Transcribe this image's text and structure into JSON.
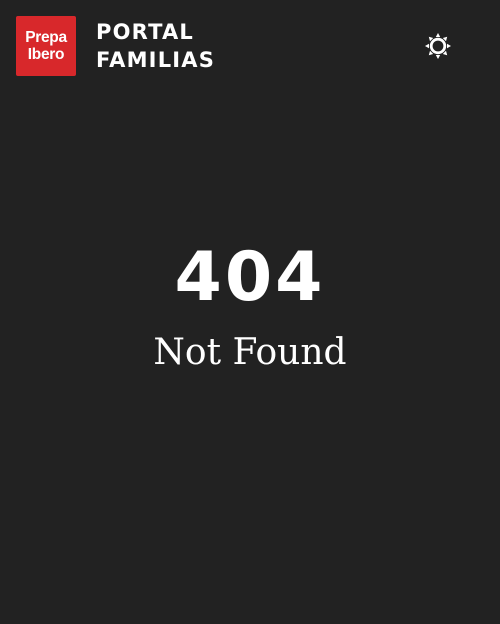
{
  "header": {
    "logo": {
      "line1": "Prepa",
      "line2": "Ibero",
      "color": "#d8282b"
    },
    "brand": {
      "line1": "PORTAL",
      "line2": "FAMILIAS"
    },
    "theme_toggle_icon": "sun-icon"
  },
  "main": {
    "status_code": "404",
    "message": "Not Found"
  },
  "colors": {
    "background": "#222222",
    "text": "#ffffff",
    "brand_red": "#d8282b"
  }
}
